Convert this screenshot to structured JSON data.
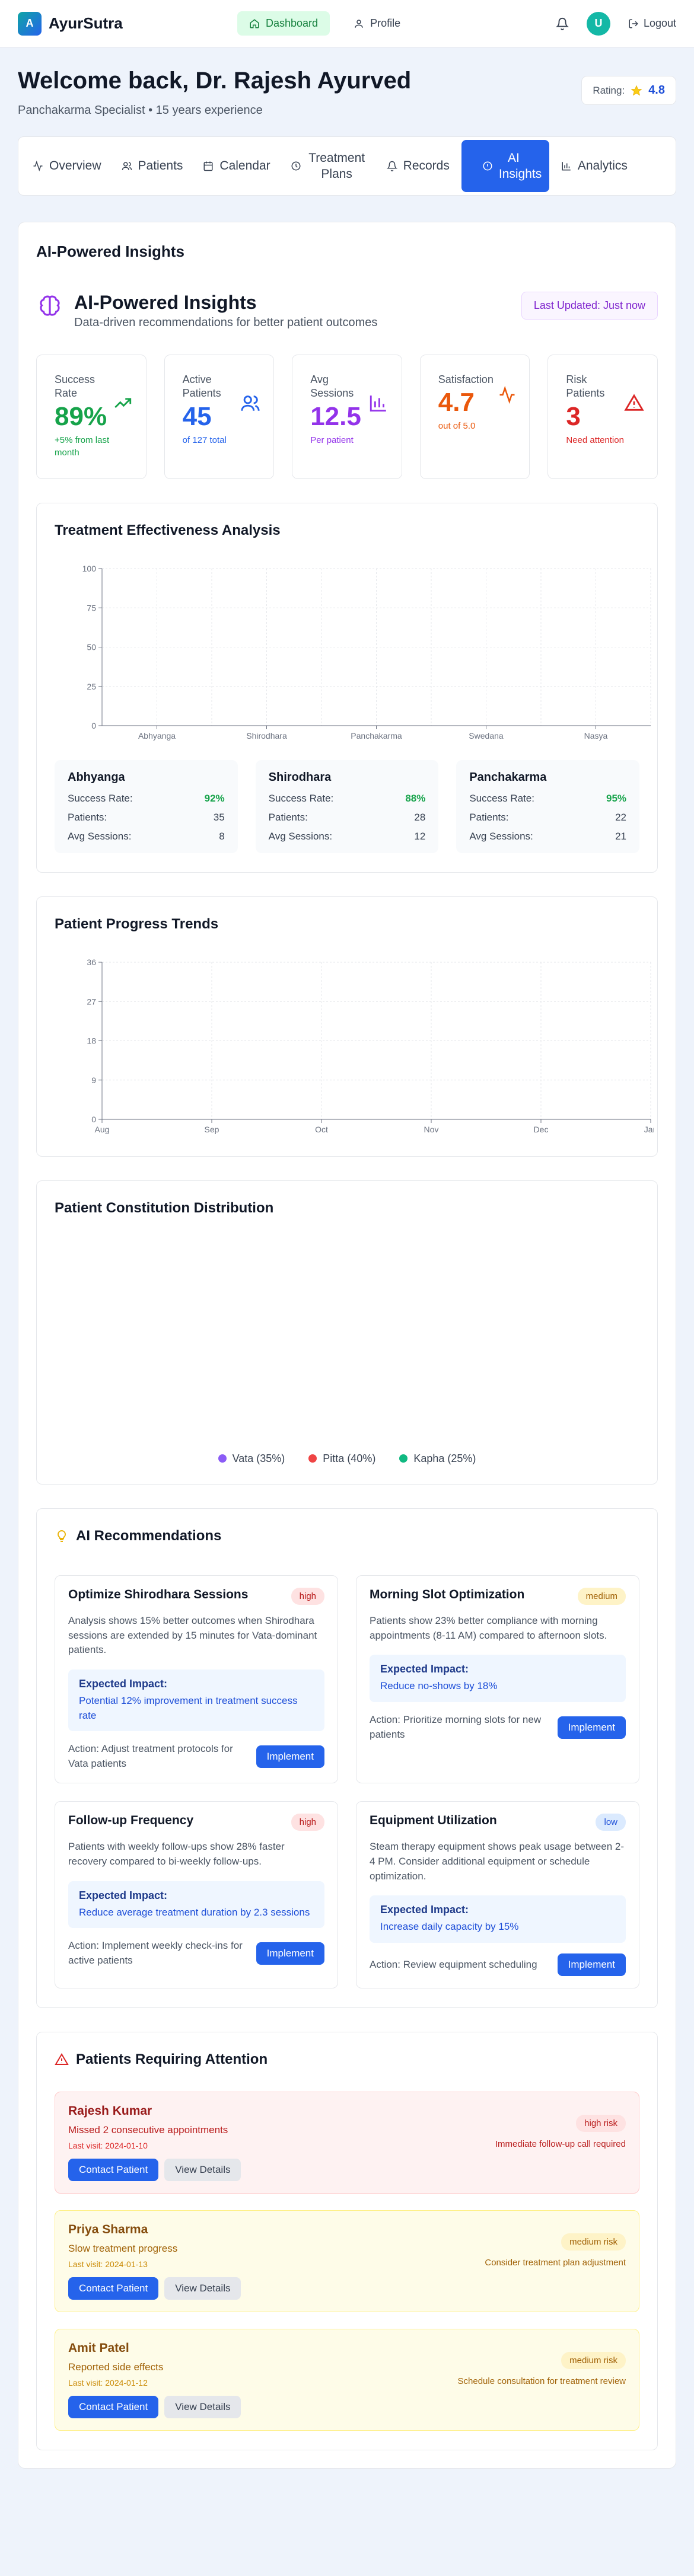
{
  "nav": {
    "brand_letter": "A",
    "brand": "AyurSutra",
    "links": [
      {
        "label": "Dashboard",
        "icon": "home-icon"
      },
      {
        "label": "Profile",
        "icon": "user-icon"
      }
    ],
    "avatar_letter": "U",
    "logout": "Logout"
  },
  "welcome": {
    "title": "Welcome back, Dr. Rajesh Ayurved",
    "subtitle": "Panchakarma Specialist • 15 years experience",
    "rating_label": "Rating:",
    "rating_value": "4.8"
  },
  "tabs": [
    {
      "label": "Overview",
      "icon": "activity-icon"
    },
    {
      "label": "Patients",
      "icon": "users-icon"
    },
    {
      "label": "Calendar",
      "icon": "calendar-icon"
    },
    {
      "label": "Treatment Plans",
      "icon": "clock-icon"
    },
    {
      "label": "Records",
      "icon": "bell-icon"
    },
    {
      "label": "AI Insights",
      "icon": "info-icon",
      "active": true
    },
    {
      "label": "Analytics",
      "icon": "bar-chart-icon"
    }
  ],
  "main": {
    "title": "AI-Powered Insights",
    "hero_title": "AI-Powered Insights",
    "hero_sub": "Data-driven recommendations for better patient outcomes",
    "updated": "Last Updated: Just now"
  },
  "stats": [
    {
      "label": "Success Rate",
      "value": "89%",
      "note": "+5% from last month",
      "color": "#16a34a",
      "note_color": "#16a34a",
      "icon": "trending-up-icon"
    },
    {
      "label": "Active Patients",
      "value": "45",
      "note": "of 127 total",
      "color": "#2563eb",
      "note_color": "#2563eb",
      "icon": "users-icon"
    },
    {
      "label": "Avg Sessions",
      "value": "12.5",
      "note": "Per patient",
      "color": "#9333ea",
      "note_color": "#9333ea",
      "icon": "bar-chart-icon"
    },
    {
      "label": "Satisfaction",
      "value": "4.7",
      "note": "out of 5.0",
      "color": "#ea580c",
      "note_color": "#ea580c",
      "icon": "activity-icon"
    },
    {
      "label": "Risk Patients",
      "value": "3",
      "note": "Need attention",
      "color": "#dc2626",
      "note_color": "#dc2626",
      "icon": "alert-triangle-icon"
    }
  ],
  "effectiveness": {
    "title": "Treatment Effectiveness Analysis",
    "cards": [
      {
        "name": "Abhyanga",
        "success": "92%",
        "patients": "35",
        "avg": "8"
      },
      {
        "name": "Shirodhara",
        "success": "88%",
        "patients": "28",
        "avg": "12"
      },
      {
        "name": "Panchakarma",
        "success": "95%",
        "patients": "22",
        "avg": "21"
      }
    ],
    "labels": {
      "success": "Success Rate:",
      "patients": "Patients:",
      "avg": "Avg Sessions:"
    }
  },
  "progress": {
    "title": "Patient Progress Trends"
  },
  "constitution": {
    "title": "Patient Constitution Distribution",
    "legend": [
      {
        "label": "Vata (35%)",
        "color": "#8b5cf6"
      },
      {
        "label": "Pitta (40%)",
        "color": "#ef4444"
      },
      {
        "label": "Kapha (25%)",
        "color": "#10b981"
      }
    ]
  },
  "chart_data": [
    {
      "type": "bar",
      "categories": [
        "Abhyanga",
        "Shirodhara",
        "Panchakarma",
        "Swedana",
        "Nasya"
      ],
      "values": [],
      "yticks": [
        "0",
        "25",
        "50",
        "75",
        "100"
      ],
      "ylim": [
        0,
        100
      ],
      "grid": true
    },
    {
      "type": "line",
      "categories": [
        "Aug",
        "Sep",
        "Oct",
        "Nov",
        "Dec",
        "Jan"
      ],
      "values": [],
      "yticks": [
        "0",
        "9",
        "18",
        "27",
        "36"
      ],
      "ylim": [
        0,
        36
      ],
      "grid": true
    },
    {
      "type": "pie",
      "categories": [
        "Vata",
        "Pitta",
        "Kapha"
      ],
      "values": [
        35,
        40,
        25
      ],
      "legend": "bottom"
    }
  ],
  "recommendations": {
    "title": "AI Recommendations",
    "impact_heading": "Expected Impact:",
    "implement": "Implement",
    "items": [
      {
        "title": "Optimize Shirodhara Sessions",
        "priority": "high",
        "desc": "Analysis shows 15% better outcomes when Shirodhara sessions are extended by 15 minutes for Vata-dominant patients.",
        "impact": "Potential 12% improvement in treatment success rate",
        "action": "Action: Adjust treatment protocols for Vata patients"
      },
      {
        "title": "Morning Slot Optimization",
        "priority": "medium",
        "desc": "Patients show 23% better compliance with morning appointments (8-11 AM) compared to afternoon slots.",
        "impact": "Reduce no-shows by 18%",
        "action": "Action: Prioritize morning slots for new patients"
      },
      {
        "title": "Follow-up Frequency",
        "priority": "high",
        "desc": "Patients with weekly follow-ups show 28% faster recovery compared to bi-weekly follow-ups.",
        "impact": "Reduce average treatment duration by 2.3 sessions",
        "action": "Action: Implement weekly check-ins for active patients"
      },
      {
        "title": "Equipment Utilization",
        "priority": "low",
        "desc": "Steam therapy equipment shows peak usage between 2-4 PM. Consider additional equipment or schedule optimization.",
        "impact": "Increase daily capacity by 15%",
        "action": "Action: Review equipment scheduling"
      }
    ]
  },
  "attention": {
    "title": "Patients Requiring Attention",
    "contact": "Contact Patient",
    "view": "View Details",
    "patients": [
      {
        "name": "Rajesh Kumar",
        "issue": "Missed 2 consecutive appointments",
        "last": "Last visit: 2024-01-10",
        "risk": "high risk",
        "rec": "Immediate follow-up call required",
        "level": "high"
      },
      {
        "name": "Priya Sharma",
        "issue": "Slow treatment progress",
        "last": "Last visit: 2024-01-13",
        "risk": "medium risk",
        "rec": "Consider treatment plan adjustment",
        "level": "medium"
      },
      {
        "name": "Amit Patel",
        "issue": "Reported side effects",
        "last": "Last visit: 2024-01-12",
        "risk": "medium risk",
        "rec": "Schedule consultation for treatment review",
        "level": "medium"
      }
    ]
  }
}
